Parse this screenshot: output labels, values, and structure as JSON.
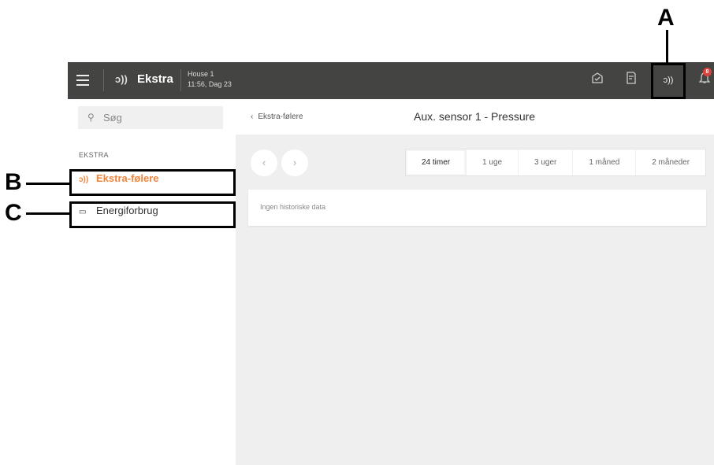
{
  "topbar": {
    "menu_icon": "hamburger-menu-icon",
    "app_icon": "sensor-signal-icon",
    "app_icon_glyph": "₃))",
    "app_name": "Ekstra",
    "house_name": "House 1",
    "house_time": "11:56, Dag 23",
    "icons": [
      "inbox-check-icon",
      "report-edit-icon",
      "sensor-signal-icon",
      "bell-icon"
    ],
    "notification_count": "8"
  },
  "sidebar": {
    "search_placeholder": "Søg",
    "section_title": "EKSTRA",
    "items": [
      {
        "label": "Ekstra-følere",
        "icon": "sensor-signal-icon",
        "active": true
      },
      {
        "label": "Energiforbrug",
        "icon": "folder-icon",
        "active": false
      }
    ]
  },
  "main": {
    "back_label": "Ekstra-følere",
    "title": "Aux. sensor 1 - Pressure",
    "tabs": [
      {
        "label": "24 timer",
        "active": true
      },
      {
        "label": "1 uge",
        "active": false
      },
      {
        "label": "3 uger",
        "active": false
      },
      {
        "label": "1 måned",
        "active": false
      },
      {
        "label": "2 måneder",
        "active": false
      }
    ],
    "empty_message": "Ingen historiske data"
  },
  "callouts": {
    "a": "A",
    "b": "B",
    "c": "C"
  },
  "colors": {
    "topbar": "#444443",
    "accent": "#f0843b",
    "badge": "#e0403a",
    "content_bg": "#efefef"
  }
}
